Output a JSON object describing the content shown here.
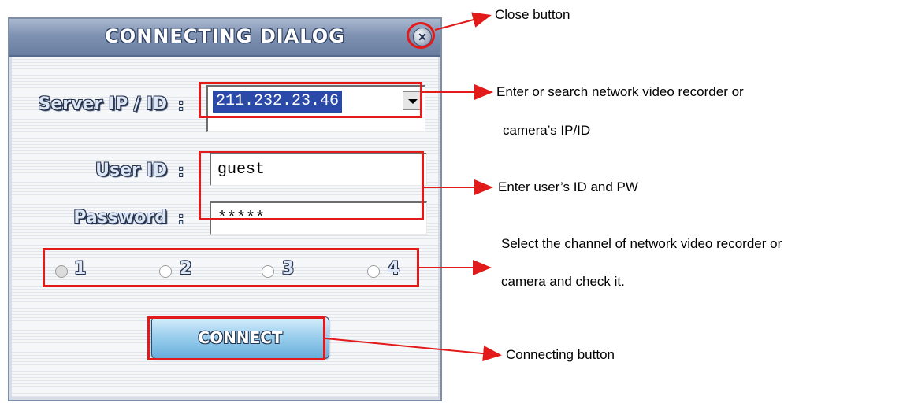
{
  "dialog": {
    "title": "CONNECTING DIALOG",
    "close_glyph": "✕",
    "server_ip_label": "Server IP / ID",
    "user_id_label": "User ID",
    "password_label": "Password",
    "colon": ":",
    "server_ip_value": "211.232.23.46",
    "user_id_value": "guest",
    "password_value": "*****",
    "channels": [
      "1",
      "2",
      "3",
      "4"
    ],
    "selected_channel": "1",
    "connect_label": "CONNECT"
  },
  "annotations": {
    "close": "Close button",
    "server_line1": "Enter or search network video recorder or",
    "server_line2": "camera’s IP/ID",
    "user": "Enter user’s ID and PW",
    "channel_line1": "Select the channel of network video recorder or",
    "channel_line2": "camera and check it.",
    "connect": "Connecting button"
  },
  "colors": {
    "annotation_red": "#e21a1a",
    "title_bar": "#7f92b2",
    "selected_input": "#2b4aa8"
  },
  "icons": {
    "close": "close-icon",
    "dropdown": "chevron-down-icon"
  }
}
